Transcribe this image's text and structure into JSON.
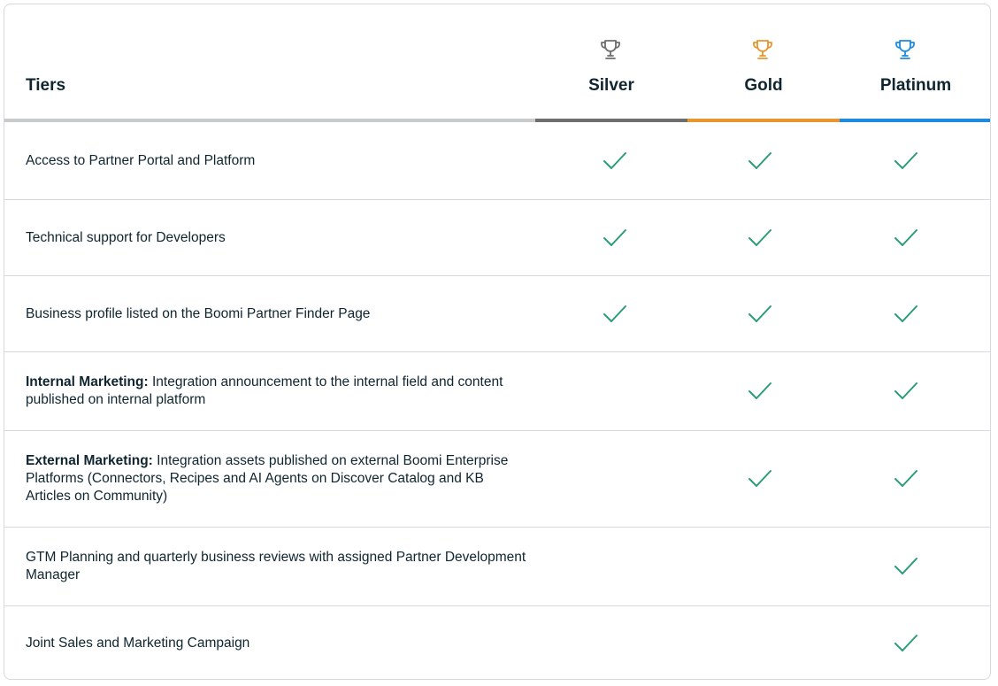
{
  "header": {
    "tiers_label": "Tiers",
    "tiers": [
      {
        "name": "Silver",
        "color": "#6e6e6e",
        "bg": "#f1f1f1",
        "icon": "trophy-icon"
      },
      {
        "name": "Gold",
        "color": "#e8962d",
        "bg": "#fdf1e2",
        "icon": "trophy-icon"
      },
      {
        "name": "Platinum",
        "color": "#1f8be0",
        "bg": "#e3f1fc",
        "icon": "trophy-icon"
      }
    ]
  },
  "colors": {
    "check": "#2a9d73",
    "divider": "#d7d9dc",
    "base_underline": "#c8cacc"
  },
  "rows": [
    {
      "bold": "",
      "text": "Access to Partner Portal and Platform",
      "silver": true,
      "gold": true,
      "platinum": true
    },
    {
      "bold": "",
      "text": "Technical support for Developers",
      "silver": true,
      "gold": true,
      "platinum": true
    },
    {
      "bold": "",
      "text": "Business profile listed on the Boomi Partner Finder Page",
      "silver": true,
      "gold": true,
      "platinum": true
    },
    {
      "bold": "Internal Marketing:",
      "text": " Integration announcement to the internal field and content published on internal platform",
      "silver": false,
      "gold": true,
      "platinum": true
    },
    {
      "bold": "External Marketing:",
      "text": " Integration assets published on external Boomi Enterprise Platforms (Connectors, Recipes and AI Agents on Discover Catalog and KB Articles on Community)",
      "silver": false,
      "gold": true,
      "platinum": true
    },
    {
      "bold": "",
      "text": "GTM Planning and quarterly business reviews with assigned Partner Development Manager",
      "silver": false,
      "gold": false,
      "platinum": true
    },
    {
      "bold": "",
      "text": "Joint Sales and Marketing Campaign",
      "silver": false,
      "gold": false,
      "platinum": true
    }
  ]
}
